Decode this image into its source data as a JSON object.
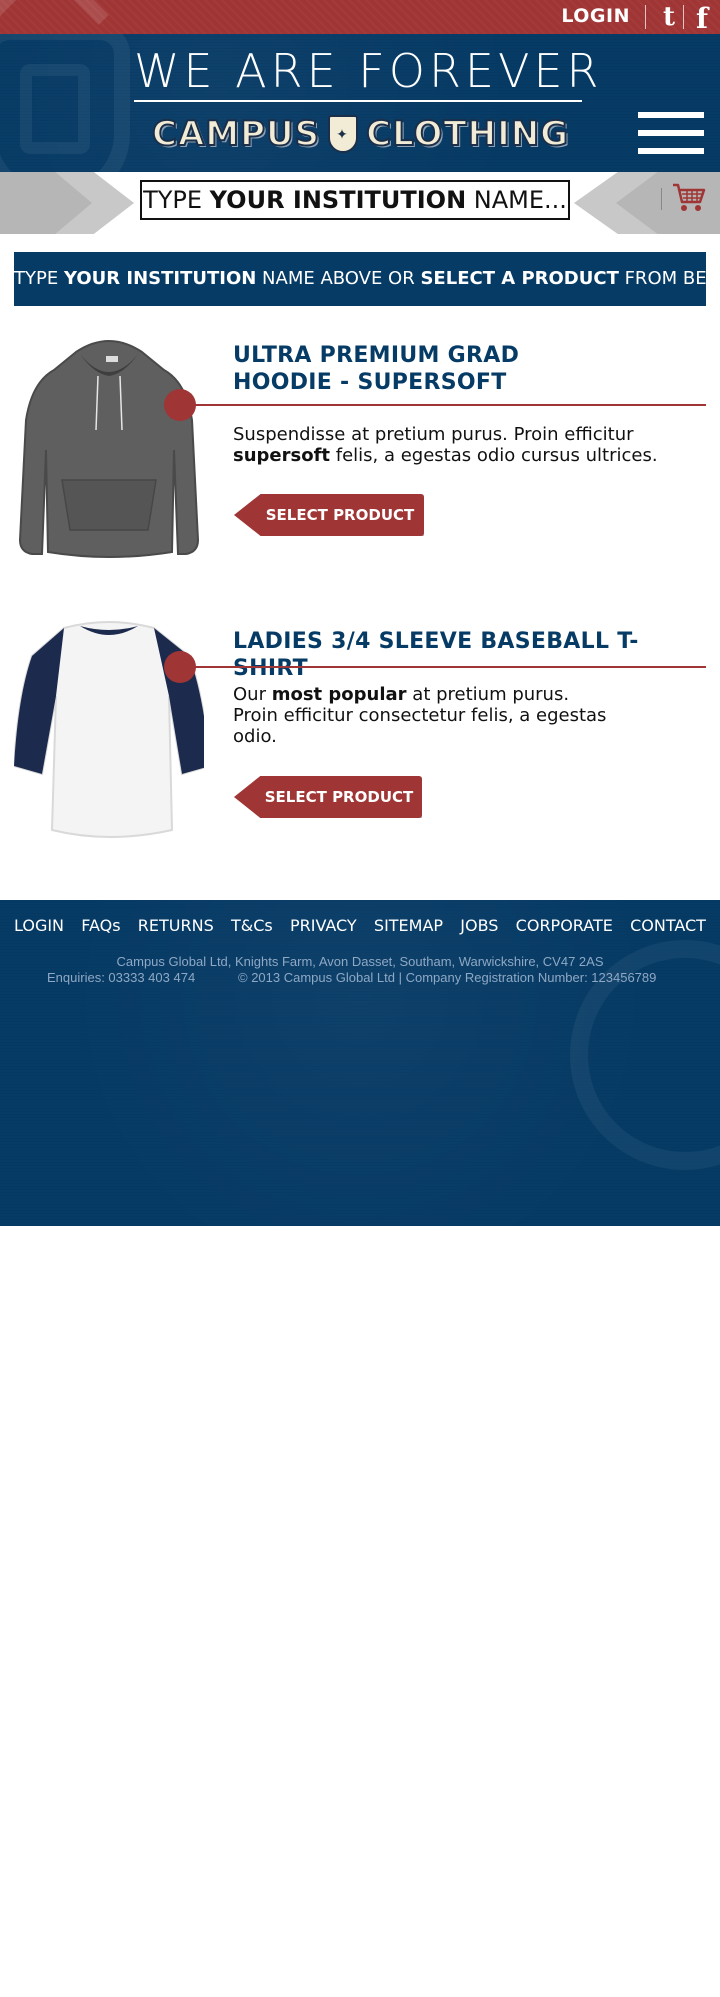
{
  "topbar": {
    "login_label": "LOGIN",
    "twitter_icon": "twitter-icon",
    "facebook_icon": "facebook-icon",
    "twitter_glyph": "t",
    "facebook_glyph": "f"
  },
  "header": {
    "tagline": "WE ARE FOREVER",
    "brand_left": "CAMPUS",
    "brand_right": "CLOTHING",
    "menu_icon": "hamburger-menu-icon"
  },
  "search": {
    "prefix": "TYPE ",
    "bold": "YOUR INSTITUTION",
    "suffix": " NAME..."
  },
  "cart": {
    "icon": "shopping-cart-icon",
    "color": "#a03535"
  },
  "banner": {
    "p1": "TYPE ",
    "b1": "YOUR INSTITUTION",
    "p2": " NAME ABOVE OR ",
    "b2": "SELECT A PRODUCT",
    "p3": " FROM BELOW"
  },
  "products": [
    {
      "title_line1": "ULTRA PREMIUM GRAD",
      "title_line2": "HOODIE - SUPERSOFT",
      "desc_pre": "Suspendisse at pretium purus. Proin efficitur ",
      "desc_bold": "supersoft",
      "desc_post": " felis, a egestas odio cursus ultrices.",
      "button": "SELECT PRODUCT",
      "image": "grey-hoodie-image"
    },
    {
      "title_line1": "LADIES 3/4 SLEEVE BASEBALL T-SHIRT",
      "desc_pre": "Our ",
      "desc_bold": "most popular",
      "desc_post": " at pretium purus. Proin efficitur consectetur felis, a egestas odio.",
      "button": "SELECT PRODUCT",
      "image": "baseball-tshirt-image"
    }
  ],
  "footer": {
    "nav": [
      "LOGIN",
      "FAQs",
      "RETURNS",
      "T&Cs",
      "PRIVACY",
      "SITEMAP",
      "JOBS",
      "CORPORATE",
      "CONTACT"
    ],
    "address": "Campus Global Ltd, Knights Farm, Avon Dasset, Southam, Warwickshire, CV47 2AS",
    "enquiries": "Enquiries: 03333 403 474",
    "copyright": "© 2013 Campus Global Ltd | Company Registration Number: 123456789"
  },
  "colors": {
    "navy": "#063b66",
    "red": "#a03535",
    "grey_band": "#c8c8c8"
  }
}
